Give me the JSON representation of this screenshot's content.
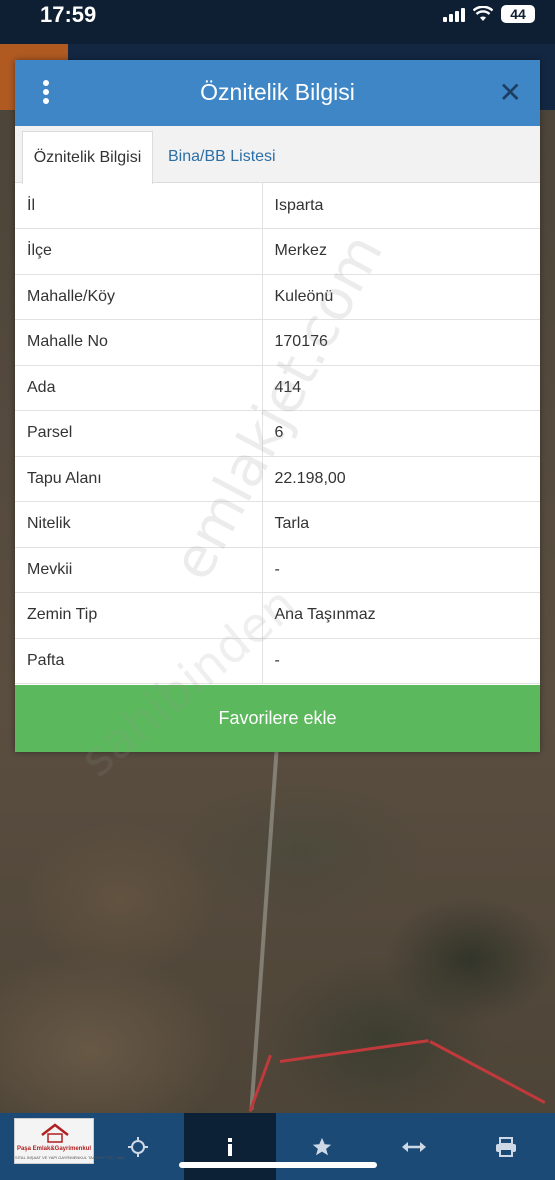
{
  "status_bar": {
    "time": "17:59",
    "battery": "44"
  },
  "modal": {
    "title": "Öznitelik Bilgisi",
    "close_glyph": "✕",
    "tabs": [
      {
        "label": "Öznitelik Bilgisi",
        "active": true
      },
      {
        "label": "Bina/BB Listesi",
        "active": false
      }
    ],
    "rows": [
      {
        "key": "İl",
        "value": "Isparta"
      },
      {
        "key": "İlçe",
        "value": "Merkez"
      },
      {
        "key": "Mahalle/Köy",
        "value": "Kuleönü"
      },
      {
        "key": "Mahalle No",
        "value": "170176"
      },
      {
        "key": "Ada",
        "value": "414"
      },
      {
        "key": "Parsel",
        "value": "6"
      },
      {
        "key": "Tapu Alanı",
        "value": "22.198,00"
      },
      {
        "key": "Nitelik",
        "value": "Tarla"
      },
      {
        "key": "Mevkii",
        "value": "-"
      },
      {
        "key": "Zemin Tip",
        "value": "Ana Taşınmaz"
      },
      {
        "key": "Pafta",
        "value": "-"
      }
    ],
    "favorite_button": "Favorilere ekle"
  },
  "watermark": {
    "primary": "emlakjet.com",
    "secondary": "sahibinden"
  },
  "toolbar": {
    "logo_text": "Paşa Emlak&Gayrimenkul",
    "logo_subtext": "SİTAL İNŞAAT VE YAPI GAYRİMENKUL TAAHHÜT TİC. SAN.",
    "items": [
      {
        "icon": "crosshair-icon"
      },
      {
        "icon": "info-icon",
        "active": true
      },
      {
        "icon": "star-icon"
      },
      {
        "icon": "measure-icon"
      },
      {
        "icon": "print-icon"
      }
    ]
  },
  "colors": {
    "header_blue": "#3e86c6",
    "button_green": "#5cb85c",
    "toolbar_blue": "#1b4a77",
    "tab_link": "#2c6fa7"
  }
}
